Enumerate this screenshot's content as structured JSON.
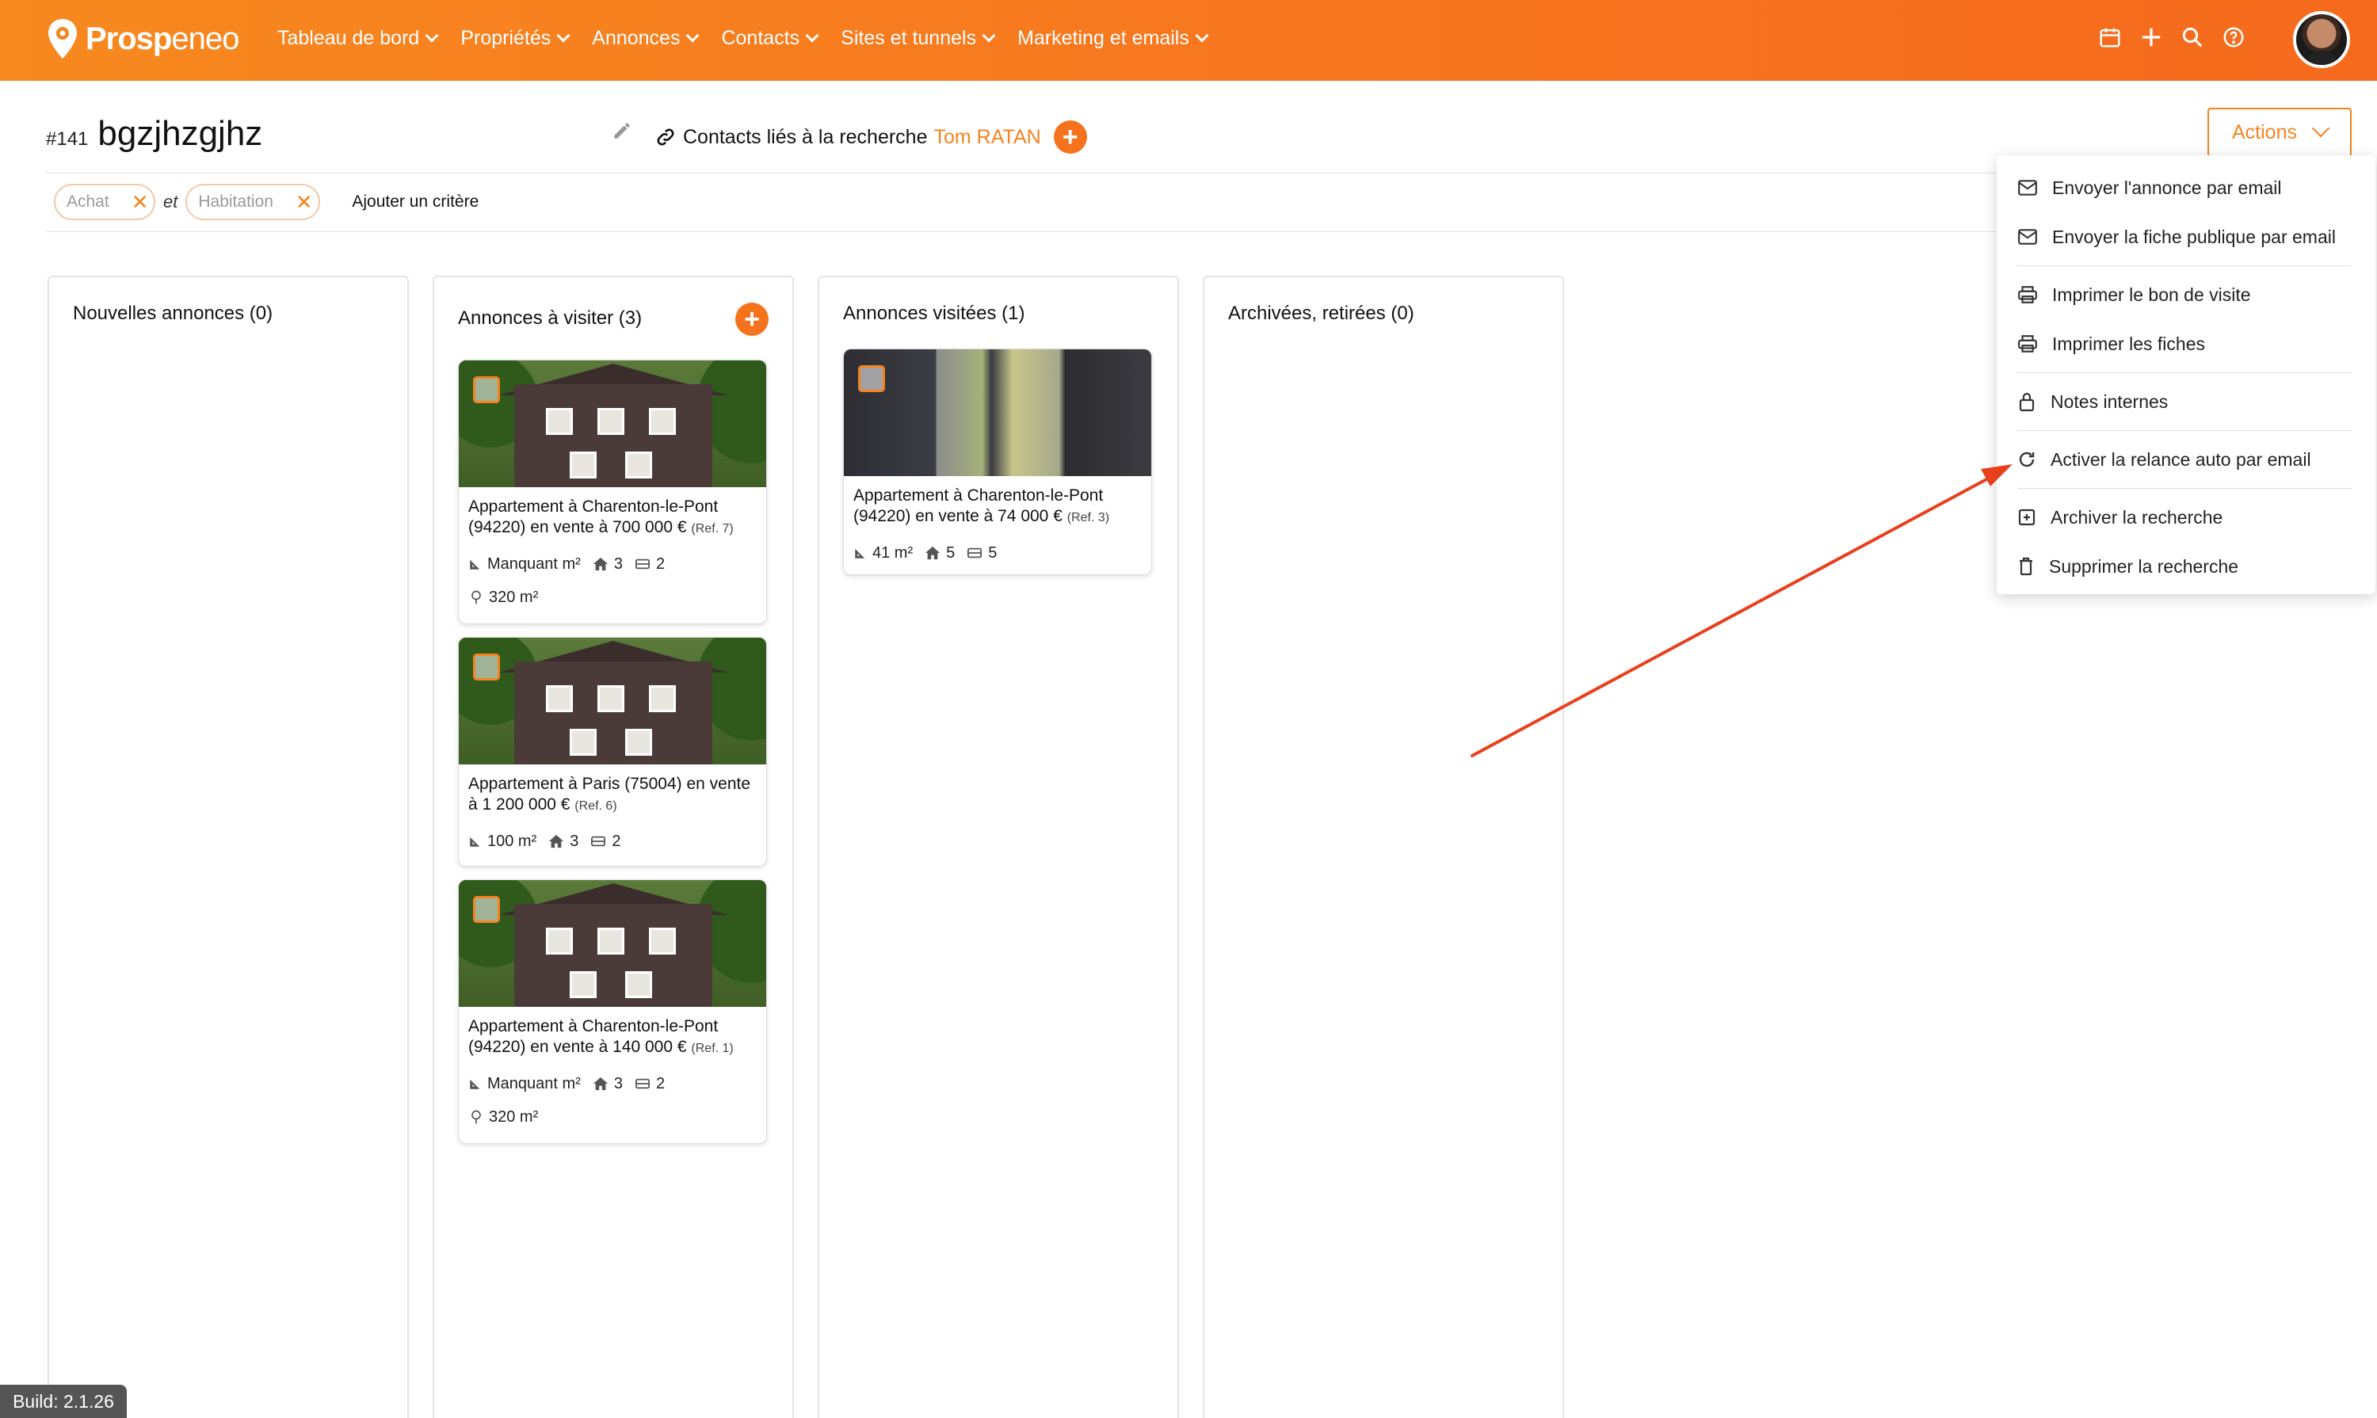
{
  "brand": {
    "name_bold": "Prosp",
    "name_light": "eneo"
  },
  "nav": [
    {
      "label": "Tableau de bord"
    },
    {
      "label": "Propriétés"
    },
    {
      "label": "Annonces"
    },
    {
      "label": "Contacts"
    },
    {
      "label": "Sites et tunnels"
    },
    {
      "label": "Marketing et emails"
    }
  ],
  "top_icons": [
    "calendar-icon",
    "plus-icon",
    "search-icon",
    "help-icon"
  ],
  "header": {
    "hash": "#141",
    "title": "bgzjhzgjhz",
    "linked_label": "Contacts liés à la recherche",
    "linked_name": "Tom RATAN",
    "add_symbol": "+"
  },
  "actions": {
    "label": "Actions"
  },
  "filters": {
    "chips": [
      {
        "label": "Achat"
      },
      {
        "label": "Habitation"
      }
    ],
    "join_word": "et",
    "add_label": "Ajouter un critère",
    "remove_symbol": "✕"
  },
  "columns": [
    {
      "title": "Nouvelles annonces (0)"
    },
    {
      "title": "Annonces à visiter (3)"
    },
    {
      "title": "Annonces visitées (1)"
    },
    {
      "title": "Archivées, retirées (0)"
    }
  ],
  "cards": [
    {
      "title": "Appartement à Charenton-le-Pont (94220) en vente à 700 000 €",
      "ref": "(Ref. 7)",
      "surface": "Manquant m²",
      "rooms": "3",
      "bedrooms": "2",
      "land": "320 m²"
    },
    {
      "title": "Appartement à Paris (75004) en vente à 1 200 000 €",
      "ref": "(Ref. 6)",
      "surface": "100 m²",
      "rooms": "3",
      "bedrooms": "2"
    },
    {
      "title": "Appartement à Charenton-le-Pont (94220) en vente à 140 000 €",
      "ref": "(Ref. 1)",
      "surface": "Manquant m²",
      "rooms": "3",
      "bedrooms": "2",
      "land": "320 m²"
    },
    {
      "title": "Appartement à Charenton-le-Pont (94220) en vente à 74 000 €",
      "ref": "(Ref. 3)",
      "surface": "41 m²",
      "rooms": "5",
      "bedrooms": "5"
    }
  ],
  "menu": [
    {
      "label": "Envoyer l'annonce par email",
      "icon": "mail-icon"
    },
    {
      "label": "Envoyer la fiche publique par email",
      "icon": "mail-icon"
    },
    {
      "label": "Imprimer le bon de visite",
      "icon": "printer-icon"
    },
    {
      "label": "Imprimer les fiches",
      "icon": "printer-icon"
    },
    {
      "label": "Notes internes",
      "icon": "lock-icon"
    },
    {
      "label": "Activer la relance auto par email",
      "icon": "refresh-icon"
    },
    {
      "label": "Archiver la recherche",
      "icon": "archive-icon"
    },
    {
      "label": "Supprimer la recherche",
      "icon": "trash-icon"
    }
  ],
  "build": "Build: 2.1.26",
  "colors": {
    "accent": "#f5831f",
    "annotation_arrow": "#e8401c"
  }
}
